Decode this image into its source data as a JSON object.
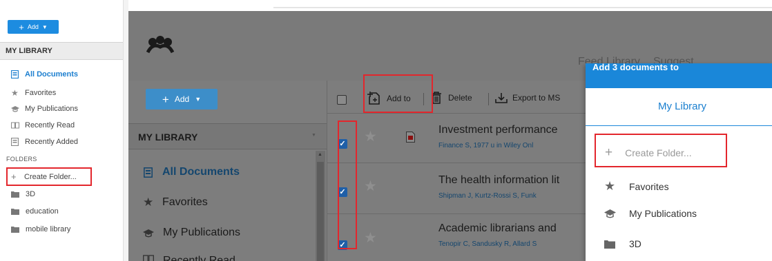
{
  "left_panel": {
    "add_label": "Add",
    "section_title": "MY LIBRARY",
    "items": [
      {
        "label": "All Documents",
        "icon": "document-list-icon"
      },
      {
        "label": "Favorites",
        "icon": "star-icon"
      },
      {
        "label": "My Publications",
        "icon": "graduation-cap-icon"
      },
      {
        "label": "Recently Read",
        "icon": "open-book-icon"
      },
      {
        "label": "Recently Added",
        "icon": "document-list-icon"
      }
    ],
    "folders_title": "FOLDERS",
    "create_folder": "Create Folder...",
    "folders": [
      "3D",
      "education",
      "mobile library"
    ]
  },
  "main": {
    "nav": {
      "feed": "Feed",
      "library": "Library",
      "suggest": "Suggest"
    },
    "add_label": "Add",
    "section_title": "MY LIBRARY",
    "sidebar_items": [
      "All Documents",
      "Favorites",
      "My Publications",
      "Recently Read"
    ],
    "toolbar": {
      "add_to": "Add to",
      "delete": "Delete",
      "export": "Export to MS"
    },
    "documents": [
      {
        "title": "Investment performance",
        "meta": "Finance S, 1977 u in Wiley Onl",
        "has_pdf": true
      },
      {
        "title": "The health information lit",
        "meta": "Shipman J, Kurtz-Rossi S, Funk",
        "has_pdf": false
      },
      {
        "title": "Academic librarians and",
        "meta": "Tenopir C, Sandusky R, Allard S",
        "has_pdf": false
      }
    ]
  },
  "popup": {
    "header": "Add 3 documents to",
    "my_library": "My Library",
    "create_folder": "Create Folder...",
    "items": [
      {
        "label": "Favorites",
        "icon": "star-icon"
      },
      {
        "label": "My Publications",
        "icon": "graduation-cap-icon"
      },
      {
        "label": "3D",
        "icon": "folder-icon"
      }
    ]
  },
  "colors": {
    "accent": "#1d8ce0",
    "popup_header": "#1a87d9",
    "highlight": "#e3262c",
    "checkbox": "#1f5fa8"
  }
}
